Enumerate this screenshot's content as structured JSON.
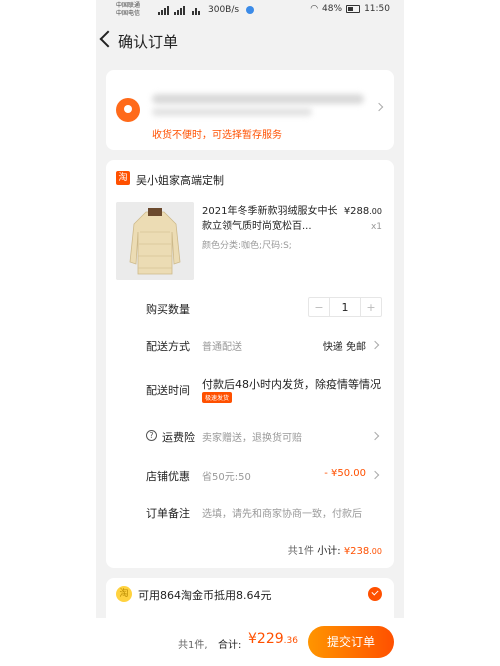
{
  "status_bar": {
    "carrier_1": "中国联通",
    "carrier_2": "中国电信",
    "speed": "300B/s",
    "battery": "48%",
    "time": "11:50"
  },
  "nav": {
    "title": "确认订单"
  },
  "address": {
    "note": "收货不便时，可选择暂存服务"
  },
  "order": {
    "shop_badge": "淘",
    "shop_name": "吴小姐家高端定制",
    "product": {
      "title": "2021年冬季新款羽绒服女中长款立领气质时尚宽松百...",
      "spec": "颜色分类:咖色;尺码:S;",
      "price_main": "¥288",
      "price_dec": ".00",
      "qty": "x1"
    },
    "quantity": {
      "label": "购买数量",
      "minus": "−",
      "value": "1",
      "plus": "+"
    },
    "shipping": {
      "label": "配送方式",
      "value": "普通配送",
      "right": "快递 免邮"
    },
    "delivery": {
      "label": "配送时间",
      "text": "付款后48小时内发货，除疫情等情况",
      "tag": "极速发货"
    },
    "insurance": {
      "icon": "?",
      "label": "运费险",
      "value": "卖家赠送，退换货可赔"
    },
    "shop_discount": {
      "label": "店铺优惠",
      "value": "省50元:50",
      "right": "- ¥50.00"
    },
    "remark": {
      "label": "订单备注",
      "placeholder": "选填，请先和商家协商一致，付款后"
    },
    "subtotal": {
      "count": "共1件",
      "label": "小计:",
      "price_main": "¥238",
      "price_dec": ".00"
    }
  },
  "coins": {
    "icon": "淘",
    "text": "可用864淘金币抵用8.64元"
  },
  "bottom": {
    "count": "共1件,",
    "total_label": "合计:",
    "total_main": "¥229",
    "total_dec": ".36",
    "submit": "提交订单"
  },
  "colors": {
    "accent": "#ff5000",
    "background": "#f2f2f2"
  }
}
